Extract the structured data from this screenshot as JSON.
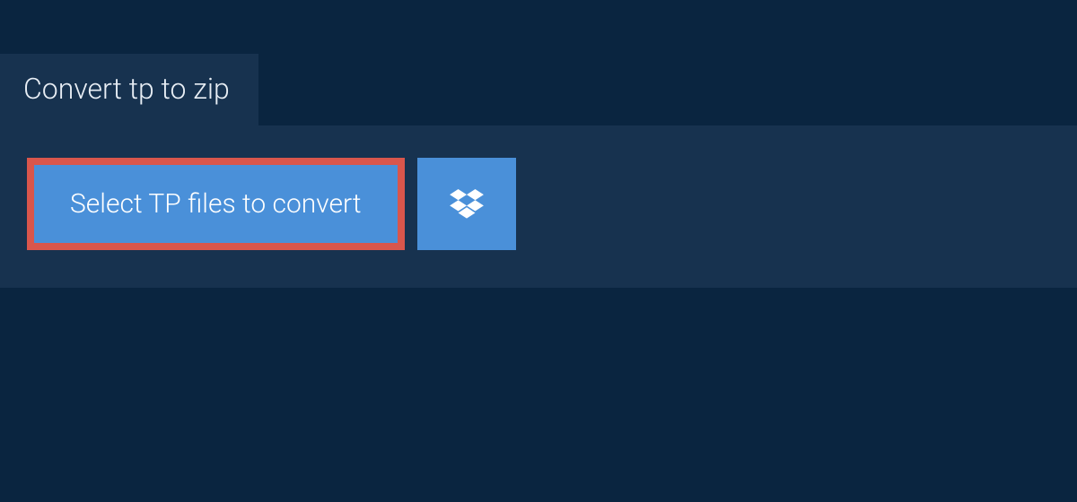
{
  "tab": {
    "label": "Convert tp to zip"
  },
  "actions": {
    "select_label": "Select TP files to convert",
    "dropbox_icon": "dropbox-icon"
  },
  "colors": {
    "background": "#0a2540",
    "panel": "#17324f",
    "button": "#4a90d9",
    "highlight_border": "#d9564c",
    "text_light": "#e8eef5",
    "text_white": "#ffffff"
  }
}
